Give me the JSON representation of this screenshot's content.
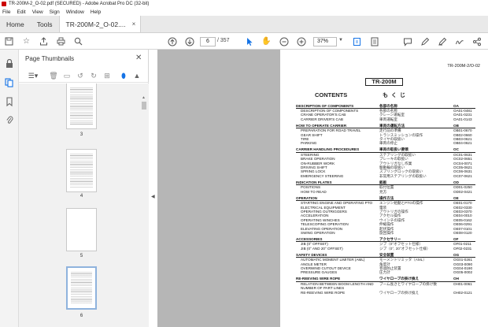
{
  "window": {
    "title": "TR-200M-2_O-02.pdf (SECURED) - Adobe Acrobat Pro DC (32-bit)"
  },
  "menu": [
    "File",
    "Edit",
    "View",
    "Sign",
    "Window",
    "Help"
  ],
  "tabs": {
    "home": "Home",
    "tools": "Tools",
    "document": "TR-200M-2_O-02....",
    "close": "×"
  },
  "toolbar": {
    "current_page": "6",
    "total_pages": "/ 357",
    "zoom": "37%"
  },
  "sidebar": {
    "title": "Page Thumbnails",
    "thumbnails": [
      {
        "label": "3"
      },
      {
        "label": "4"
      },
      {
        "label": "5"
      },
      {
        "label": "6"
      }
    ]
  },
  "page": {
    "doc_id": "TR-200M-2/O-02",
    "model": "TR-200M",
    "contents_en": "CONTENTS",
    "contents_jp": "もくじ",
    "sections": [
      {
        "en": "DESCRIPTION OF COMPONENTS",
        "jp": "各部の名称",
        "code": "OA",
        "rows": [
          {
            "en": "DESCRIPTION OF COMPONENTS",
            "jp": "各部の名称",
            "code": "OA01-0481"
          },
          {
            "en": "CRANE OPERATOR'S CAB",
            "jp": "クレーン運転室",
            "code": "OA01-0231"
          },
          {
            "en": "CARRIER DRIVER'S CAB",
            "jp": "車両運転室",
            "code": "OA01-0143"
          }
        ]
      },
      {
        "en": "HOW TO OPERATE CARRIER",
        "jp": "車両の運転方法",
        "code": "OB",
        "rows": [
          {
            "en": "PREPARATION FOR ROAD TRAVEL",
            "jp": "走行前の準備",
            "code": "OB01-0670"
          },
          {
            "en": "GEAR SHIFT",
            "jp": "トランスミッションの操作",
            "code": "OB02-0660"
          },
          {
            "en": "TIRE",
            "jp": "タイヤの取扱い",
            "code": "OB03-0621"
          },
          {
            "en": "PARKING",
            "jp": "車両の停止",
            "code": "OB04-0621"
          }
        ]
      },
      {
        "en": "CARRIER HANDLING PROCEDURES",
        "jp": "車両の取扱い要領",
        "code": "OC",
        "rows": [
          {
            "en": "STEERING",
            "jp": "ステアリングの取扱い",
            "code": "OC01-0631"
          },
          {
            "en": "BRAKE OPERATION",
            "jp": "ブレーキの取扱い",
            "code": "OC02-0651"
          },
          {
            "en": "ON-RUBBER WORK",
            "jp": "アウトリガなし作業",
            "code": "OC04-0071"
          },
          {
            "en": "DRIVING SHIFT",
            "jp": "駆動輪の取扱い",
            "code": "OC05-0621"
          },
          {
            "en": "SPRING LOCK",
            "jp": "スプリングロックの取扱い",
            "code": "OC06-0631"
          },
          {
            "en": "EMERGENCY STEERING",
            "jp": "非常用ステアリングの取扱い",
            "code": "OC07-0621"
          }
        ]
      },
      {
        "en": "INDICATION PLATES",
        "jp": "銘板",
        "code": "OD",
        "rows": [
          {
            "en": "POSITIONS",
            "jp": "取付位置",
            "code": "OD01-0250"
          },
          {
            "en": "HOW TO READ",
            "jp": "見方",
            "code": "OD02-0421"
          }
        ]
      },
      {
        "en": "OPERATION",
        "jp": "操作方法",
        "code": "OE",
        "rows": [
          {
            "en": "STARTING ENGINE AND OPERATING PTO",
            "jp": "エンジン始動とPTOの操作",
            "code": "OE01-0170"
          },
          {
            "en": "ELECTRICAL EQUIPMENT",
            "jp": "電装",
            "code": "OE02-0330"
          },
          {
            "en": "OPERATING OUTRIGGERS",
            "jp": "アウトリガの操作",
            "code": "OE03-0370"
          },
          {
            "en": "ACCELERATION",
            "jp": "アクセル操作",
            "code": "OE04-0010"
          },
          {
            "en": "OPERATING WINCHES",
            "jp": "ウインチの操作",
            "code": "OE05-0162"
          },
          {
            "en": "TELESCOPING OPERATION",
            "jp": "伸縮操作",
            "code": "OE06-0291"
          },
          {
            "en": "ELEVATING OPERATION",
            "jp": "起伏操作",
            "code": "OE07-0101"
          },
          {
            "en": "SWING OPERATION",
            "jp": "旋回操作",
            "code": "OE08-0120"
          }
        ]
      },
      {
        "en": "ACCESSORIES",
        "jp": "アクセサリー",
        "code": "OF",
        "rows": [
          {
            "en": "JIB (0° OFFSET)",
            "jp": "ジブ（0°オフセット仕様）",
            "code": "OF01-0211"
          },
          {
            "en": "JIB (0° AND 20° OFFSET)",
            "jp": "ジブ（0°, 20°オフセット仕様）",
            "code": "OF02-0231"
          }
        ]
      },
      {
        "en": "SAFETY DEVICES",
        "jp": "安全装置",
        "code": "OG",
        "rows": [
          {
            "en": "AUTOMATIC MOMENT LIMITER (AML)",
            "jp": "モーメントリミッタ（AML）",
            "code": "OG01-0261"
          },
          {
            "en": "ANGLE METER",
            "jp": "角度計",
            "code": "OG03-0090"
          },
          {
            "en": "OVERWIND CUTOUT DEVICE",
            "jp": "巻過防止装置",
            "code": "OG04-0190"
          },
          {
            "en": "PRESSURE GAUGES",
            "jp": "圧力計",
            "code": "OG05-0002"
          }
        ]
      },
      {
        "en": "RE-REEVING WIRE ROPE",
        "jp": "ワイヤロープの掛け換え",
        "code": "OH",
        "rows": [
          {
            "en": "RELATION BETWEEN BOOM LENGTH AND NUMBER OF PART LINES",
            "jp": "ブーム長さとワイヤロープの掛け数",
            "code": "OH01-0061"
          },
          {
            "en": "RE-REEVING WIRE ROPE",
            "jp": "ワイヤロープの掛け換え",
            "code": "OH02-0121"
          }
        ]
      }
    ]
  }
}
